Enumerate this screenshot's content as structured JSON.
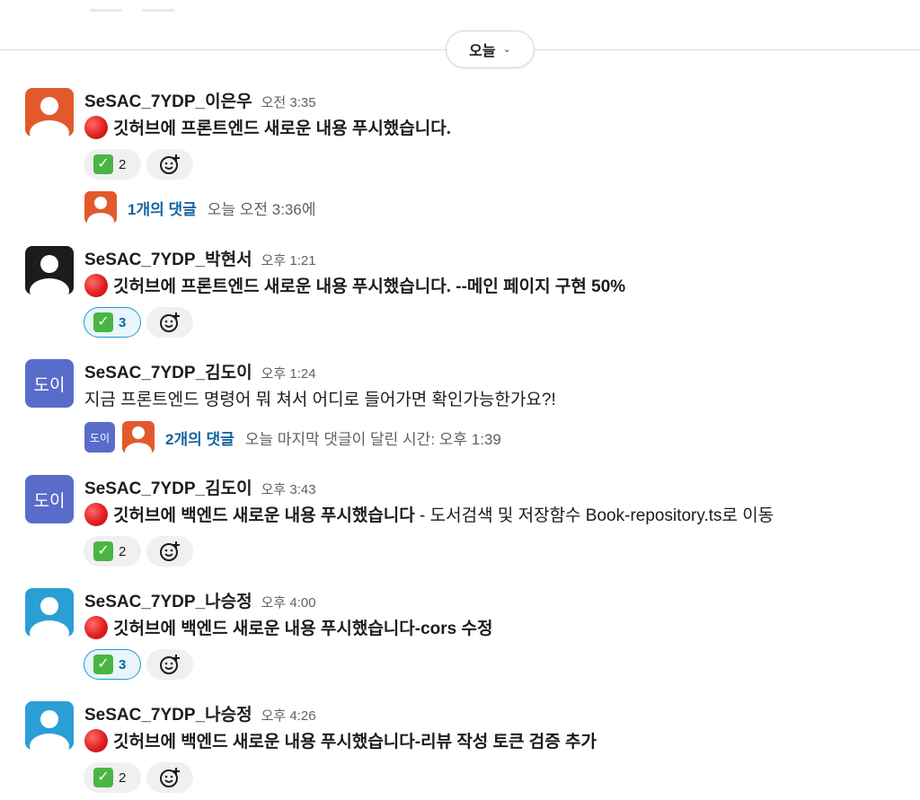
{
  "divider": {
    "date_label": "오늘"
  },
  "messages": [
    {
      "author": "SeSAC_7YDP_이은우",
      "time": "오전 3:35",
      "text_bold": "깃허브에 프론트엔드 새로운 내용 푸시했습니다.",
      "text_rest": "",
      "reaction_count": "2",
      "reaction_active": false,
      "avatar_color": "#e25a2c",
      "thread_link": "1개의 댓글",
      "thread_meta": "오늘 오전 3:36에"
    },
    {
      "author": "SeSAC_7YDP_박현서",
      "time": "오후 1:21",
      "text_bold": "깃허브에 프론트엔드 새로운 내용 푸시했습니다. --메인 페이지 구현 50%",
      "text_rest": "",
      "reaction_count": "3",
      "reaction_active": true,
      "avatar_color": "#1d1c1d"
    },
    {
      "author": "SeSAC_7YDP_김도이",
      "time": "오후 1:24",
      "text_plain": "지금 프론트엔드 명령어 뭐 쳐서 어디로 들어가면 확인가능한가요?!",
      "avatar_text": "도이",
      "avatar_color": "#5a6cc9",
      "thread_link": "2개의 댓글",
      "thread_meta": "오늘 마지막 댓글이 달린 시간: 오후 1:39"
    },
    {
      "author": "SeSAC_7YDP_김도이",
      "time": "오후 3:43",
      "text_bold": "깃허브에 백엔드 새로운 내용 푸시했습니다",
      "text_rest": " - 도서검색 및 저장함수 Book-repository.ts로 이동",
      "reaction_count": "2",
      "reaction_active": false,
      "avatar_text": "도이",
      "avatar_color": "#5a6cc9"
    },
    {
      "author": "SeSAC_7YDP_나승정",
      "time": "오후 4:00",
      "text_bold": "깃허브에 백엔드 새로운 내용 푸시했습니다-cors 수정",
      "text_rest": "",
      "reaction_count": "3",
      "reaction_active": true,
      "avatar_color": "#2a9fd6"
    },
    {
      "author": "SeSAC_7YDP_나승정",
      "time": "오후 4:26",
      "text_bold": "깃허브에 백엔드 새로운 내용 푸시했습니다-리뷰 작성 토큰 검증 추가",
      "text_rest": "",
      "reaction_count": "2",
      "reaction_active": false,
      "avatar_color": "#2a9fd6"
    }
  ],
  "icons": {
    "reaction_emoji": "white-check-mark-icon",
    "add_reaction": "add-reaction-icon",
    "status": "red-circle-icon"
  },
  "colors": {
    "link": "#1264a3",
    "active_reaction_border": "#1d9bd1"
  }
}
